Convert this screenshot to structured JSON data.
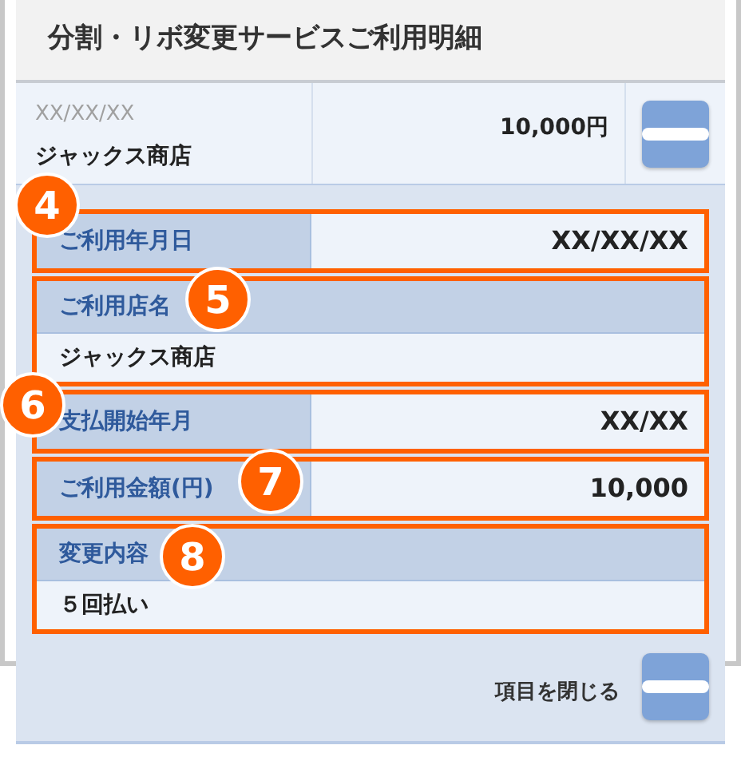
{
  "header": {
    "title": "分割・リボ変更サービスご利用明細"
  },
  "summary": {
    "date": "XX/XX/XX",
    "store": "ジャックス商店",
    "amount": "10,000円",
    "expanded": true
  },
  "details": [
    {
      "kind": "inline",
      "label": "ご利用年月日",
      "value": "XX/XX/XX",
      "callout": "4"
    },
    {
      "kind": "stacked",
      "label": "ご利用店名",
      "value": "ジャックス商店",
      "callout": "5"
    },
    {
      "kind": "inline",
      "label": "支払開始年月",
      "value": "XX/XX",
      "callout": "6"
    },
    {
      "kind": "inline",
      "label": "ご利用金額(円)",
      "value": "10,000",
      "callout": "7"
    },
    {
      "kind": "stacked",
      "label": "変更内容",
      "value": "５回払い",
      "callout": "8"
    }
  ],
  "footer": {
    "close_label": "項目を閉じる",
    "expanded": true
  }
}
